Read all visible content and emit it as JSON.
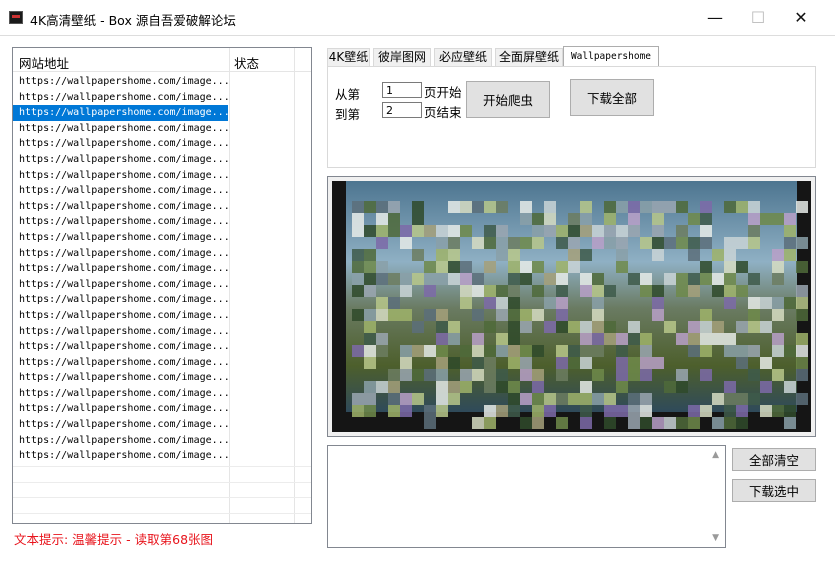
{
  "window": {
    "title": "4K高清壁纸 - Box    源自吾爱破解论坛",
    "minimize_glyph": "—",
    "maximize_glyph": "☐",
    "close_glyph": "✕",
    "icon": "app-icon"
  },
  "url_list": {
    "columns": [
      "网站地址",
      "状态"
    ],
    "selected_index": 2,
    "rows": [
      "https://wallpapershome.com/image...",
      "https://wallpapershome.com/image...",
      "https://wallpapershome.com/image...",
      "https://wallpapershome.com/image...",
      "https://wallpapershome.com/image...",
      "https://wallpapershome.com/image...",
      "https://wallpapershome.com/image...",
      "https://wallpapershome.com/image...",
      "https://wallpapershome.com/image...",
      "https://wallpapershome.com/image...",
      "https://wallpapershome.com/image...",
      "https://wallpapershome.com/image...",
      "https://wallpapershome.com/image...",
      "https://wallpapershome.com/image...",
      "https://wallpapershome.com/image...",
      "https://wallpapershome.com/image...",
      "https://wallpapershome.com/image...",
      "https://wallpapershome.com/image...",
      "https://wallpapershome.com/image...",
      "https://wallpapershome.com/image...",
      "https://wallpapershome.com/image...",
      "https://wallpapershome.com/image...",
      "https://wallpapershome.com/image...",
      "https://wallpapershome.com/image...",
      "https://wallpapershome.com/image..."
    ]
  },
  "status_hint": "文本提示: 温馨提示 - 读取第68张图",
  "tabs": [
    "4K壁纸",
    "彼岸图网",
    "必应壁纸",
    "全面屏壁纸",
    "Wallpapershome"
  ],
  "active_tab": 4,
  "crawl": {
    "from_label": "从第",
    "to_label": "到第",
    "from_value": "1",
    "to_value": "2",
    "start_suffix": "页开始",
    "end_suffix": "页结束",
    "start_button": "开始爬虫",
    "download_all_button": "下载全部"
  },
  "preview": {
    "description_icon": "wallpaper-preview-image"
  },
  "actions": {
    "clear_all": "全部清空",
    "download_selected": "下载选中"
  },
  "colors": {
    "selection": "#0078d7",
    "hint_text": "#e8141c",
    "button_face": "#e1e1e1"
  }
}
